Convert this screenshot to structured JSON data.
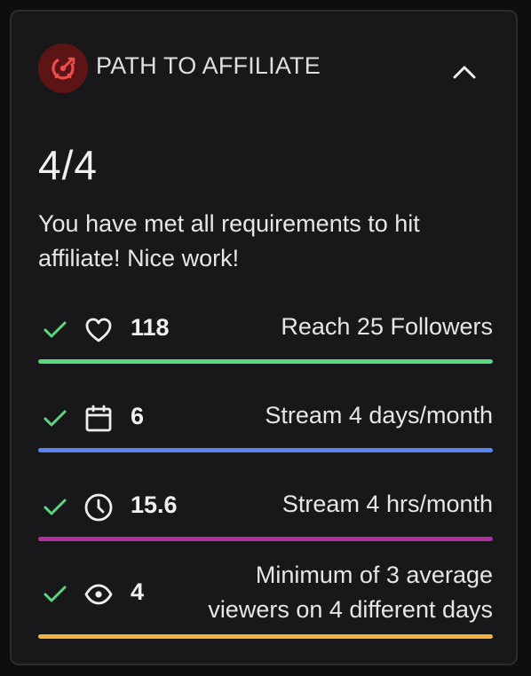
{
  "header": {
    "title": "PATH TO AFFILIATE",
    "badge_icon": "target-icon",
    "collapse_icon": "chevron-up-icon"
  },
  "progress": "4/4",
  "message": "You have met all requirements to hit affiliate! Nice work!",
  "requirements": [
    {
      "value": "118",
      "label": "Reach 25 Followers",
      "icon": "heart-icon",
      "bar_color": "#5cd67f",
      "met": true
    },
    {
      "value": "6",
      "label": "Stream 4 days/month",
      "icon": "calendar-icon",
      "bar_color": "#5a84f0",
      "met": true
    },
    {
      "value": "15.6",
      "label": "Stream 4 hrs/month",
      "icon": "clock-icon",
      "bar_color": "#b02fa3",
      "met": true
    },
    {
      "value": "4",
      "label_lines": [
        "Minimum of 3 average",
        "viewers on 4 different days"
      ],
      "icon": "eye-icon",
      "bar_color": "#f0b13f",
      "met": true
    }
  ],
  "colors": {
    "check": "#5cd67f",
    "badge_bg": "#5c1414",
    "badge_fg": "#eb4d4d",
    "card_bg": "#18181b"
  }
}
